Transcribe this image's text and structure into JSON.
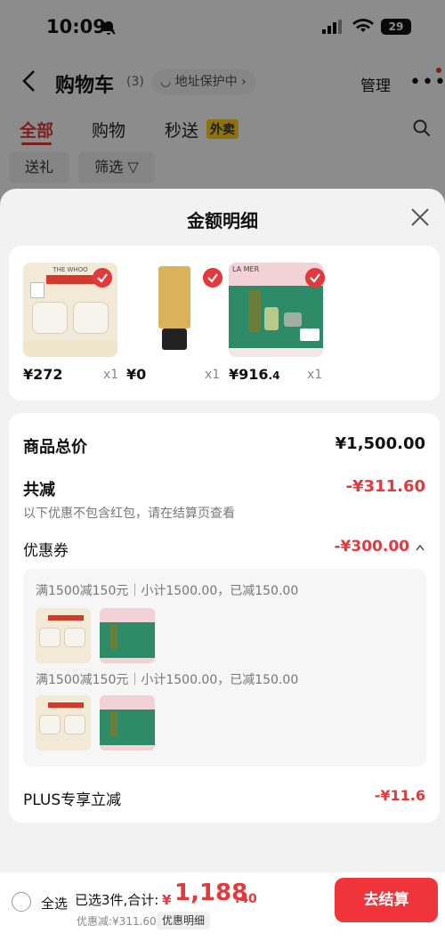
{
  "status_bar": {
    "time": "10:09",
    "battery": "29"
  },
  "nav": {
    "title": "购物车",
    "count": "(3)",
    "address_pill": "◡ 地址保护中 ›",
    "manage": "管理",
    "more": "•••"
  },
  "tabs": [
    {
      "label": "全部"
    },
    {
      "label": "购物"
    },
    {
      "label": "秒送"
    }
  ],
  "takeout_badge": "外卖",
  "chips": [
    {
      "label": "送礼"
    },
    {
      "label": "筛选 ▽"
    }
  ],
  "sheet": {
    "title": "金额明细"
  },
  "products": [
    {
      "brand": "THE WHOO",
      "price": "¥272",
      "qty": "x1"
    },
    {
      "brand": "",
      "price": "¥0",
      "qty": "x1"
    },
    {
      "brand": "LA MER",
      "price_int": "¥916",
      "price_dec": ".4",
      "qty": "x1"
    }
  ],
  "summary": {
    "total_label": "商品总价",
    "total_value": "¥1,500.00",
    "reduce_label": "共减",
    "reduce_value": "-¥311.60",
    "reduce_note": "以下优惠不包含红包，请在结算页查看",
    "coupon_label": "优惠券",
    "coupon_value": "-¥300.00",
    "coupon_lines": [
      "满1500减150元｜小计1500.00，已减150.00",
      "满1500减150元｜小计1500.00，已减150.00"
    ],
    "plus_label": "PLUS专享立减",
    "plus_value": "-¥11.6"
  },
  "bottom": {
    "select_all": "全选",
    "selected_text": "已选3件,合计:",
    "total_yen": "¥",
    "total_int": "1,188",
    "total_dec": ".40",
    "discount_text": "优惠减:¥311.60",
    "detail_pill": "优惠明细",
    "checkout": "去结算"
  },
  "colors": {
    "accent": "#e4393c",
    "checkout": "#f0343c"
  }
}
